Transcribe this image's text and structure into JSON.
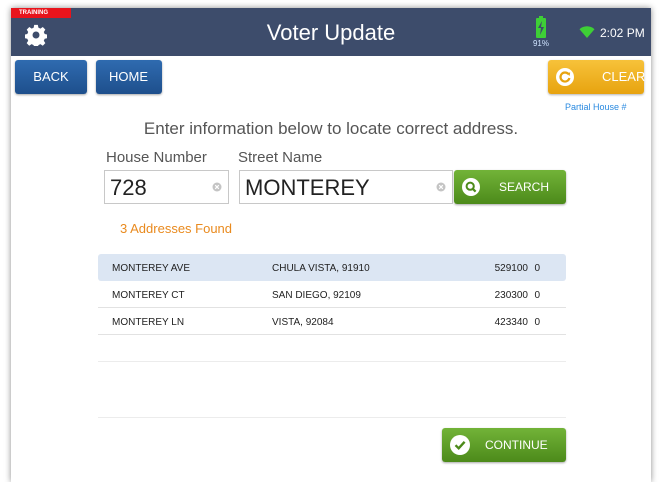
{
  "topbar": {
    "training_badge": "TRAINING",
    "title": "Voter Update",
    "battery_pct": "91%",
    "time": "2:02 PM",
    "colors": {
      "bar": "#3d4c6b",
      "badge": "#e8141c",
      "battery": "#3ecf36",
      "wifi": "#3ecf36"
    }
  },
  "nav": {
    "back": "BACK",
    "home": "HOME",
    "clear": "CLEAR"
  },
  "partial_link": "Partial House #",
  "instructions": "Enter information below to locate correct address.",
  "form": {
    "house_label": "House Number",
    "house_value": "728",
    "street_label": "Street Name",
    "street_value": "MONTEREY",
    "search_label": "SEARCH"
  },
  "results": {
    "count_text": "3 Addresses Found",
    "selected_index": 0,
    "rows": [
      {
        "street": "MONTEREY AVE",
        "city": "CHULA VISTA, 91910",
        "code": "529100",
        "flag": "0"
      },
      {
        "street": "MONTEREY CT",
        "city": "SAN DIEGO, 92109",
        "code": "230300",
        "flag": "0"
      },
      {
        "street": "MONTEREY LN",
        "city": "VISTA, 92084",
        "code": "423340",
        "flag": "0"
      }
    ]
  },
  "continue_label": "CONTINUE"
}
